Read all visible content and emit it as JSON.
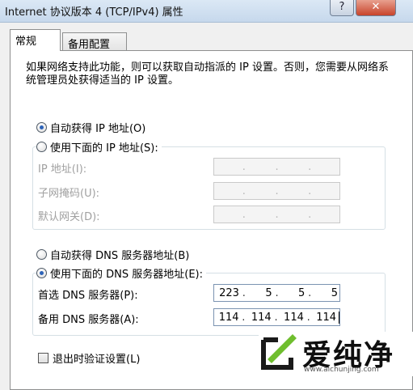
{
  "window": {
    "title": "Internet 协议版本 4 (TCP/IPv4) 属性",
    "help_label": "?",
    "close_label": "✕"
  },
  "tabs": [
    {
      "label": "常规",
      "active": true
    },
    {
      "label": "备用配置",
      "active": false
    }
  ],
  "description": "如果网络支持此功能，则可以获取自动指派的 IP 设置。否则，您需要从网络系统管理员处获得适当的 IP 设置。",
  "ip": {
    "auto_label": "自动获得 IP 地址(O)",
    "manual_label": "使用下面的 IP 地址(S):",
    "selected": "auto",
    "fields": [
      {
        "label": "IP 地址(I):",
        "octets": [
          "",
          "",
          "",
          ""
        ]
      },
      {
        "label": "子网掩码(U):",
        "octets": [
          "",
          "",
          "",
          ""
        ]
      },
      {
        "label": "默认网关(D):",
        "octets": [
          "",
          "",
          "",
          ""
        ]
      }
    ]
  },
  "dns": {
    "auto_label": "自动获得 DNS 服务器地址(B)",
    "manual_label": "使用下面的 DNS 服务器地址(E):",
    "selected": "manual",
    "fields": [
      {
        "label": "首选 DNS 服务器(P):",
        "octets": [
          "223",
          "5",
          "5",
          "5"
        ]
      },
      {
        "label": "备用 DNS 服务器(A):",
        "octets": [
          "114",
          "114",
          "114",
          "114"
        ]
      }
    ]
  },
  "validate_on_exit": {
    "label": "退出时验证设置(L)",
    "checked": false
  },
  "watermark": {
    "text": "爱纯净",
    "url": "www.aichunjing.com"
  }
}
